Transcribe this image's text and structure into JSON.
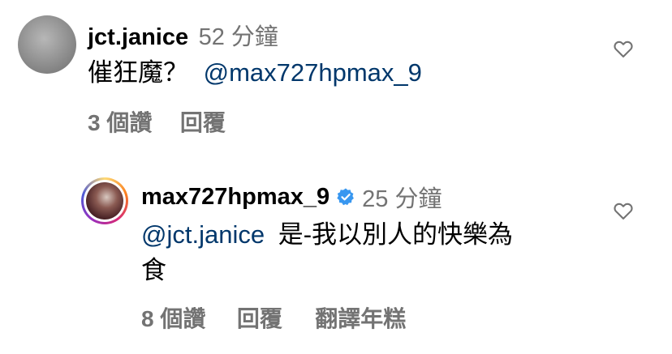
{
  "comments": [
    {
      "username": "jct.janice",
      "timestamp": "52 分鐘",
      "text": "催狂魔？",
      "mention": "@max727hpmax_9",
      "likes": "3 個讚",
      "reply": "回覆"
    },
    {
      "username": "max727hpmax_9",
      "verified": true,
      "timestamp": "25 分鐘",
      "mention": "@jct.janice",
      "text_line1": "是-我以別人的快樂為",
      "text_line2": "食",
      "likes": "8 個讚",
      "reply": "回覆",
      "translate": "翻譯年糕"
    }
  ],
  "colors": {
    "secondary_text": "#737373",
    "mention": "#00376b",
    "verified": "#3897f0"
  },
  "icons": [
    "heart-icon",
    "verified-badge-icon"
  ]
}
